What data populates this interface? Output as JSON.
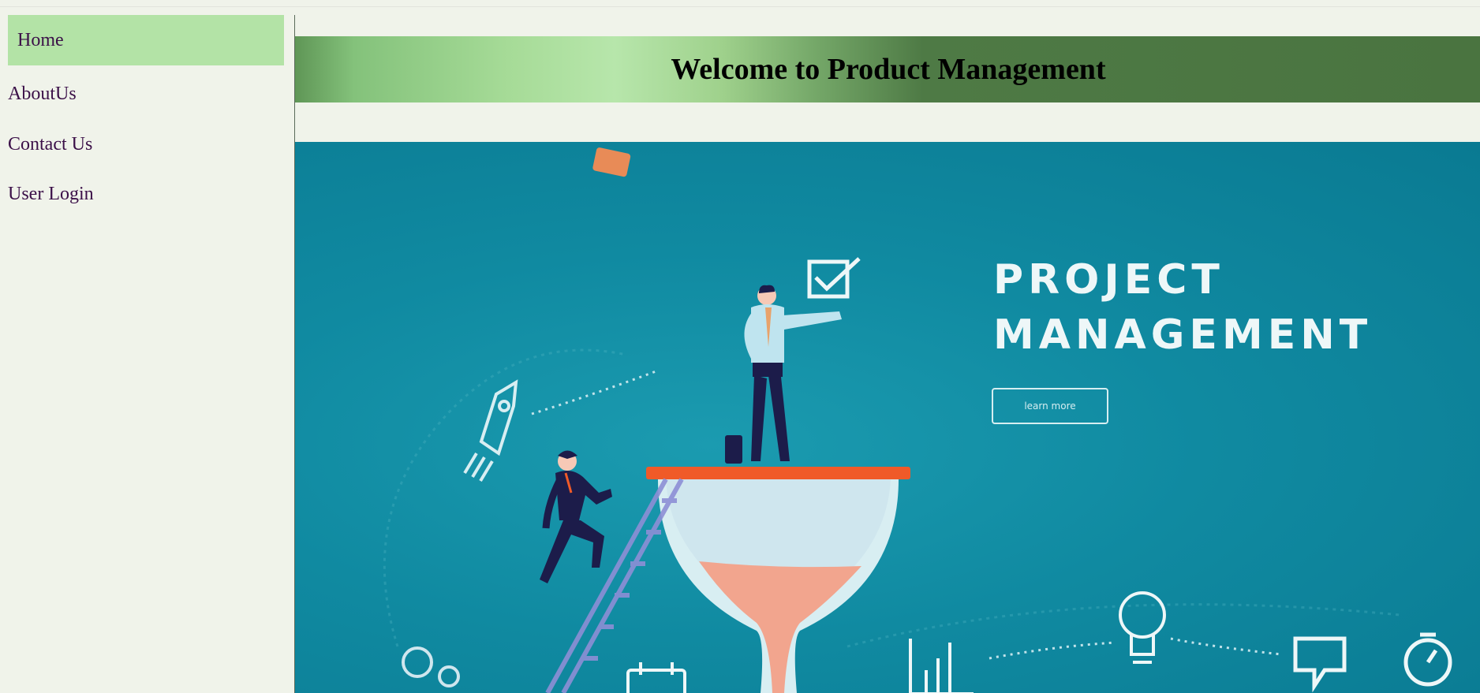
{
  "nav": {
    "items": [
      {
        "label": "Home",
        "active": true
      },
      {
        "label": "AboutUs",
        "active": false
      },
      {
        "label": "Contact Us",
        "active": false
      },
      {
        "label": "User Login",
        "active": false
      }
    ]
  },
  "header": {
    "title": "Welcome to Product Management"
  },
  "hero": {
    "title_line1": "PROJECT",
    "title_line2": "MANAGEMENT",
    "button_label": "learn more"
  },
  "colors": {
    "page_background": "#f0f3ea",
    "active_nav": "#b3e3a6",
    "nav_text": "#3b1048",
    "hero_teal": "#108aa1",
    "hourglass_sand": "#f2a58e",
    "hourglass_cap": "#f05a28"
  }
}
